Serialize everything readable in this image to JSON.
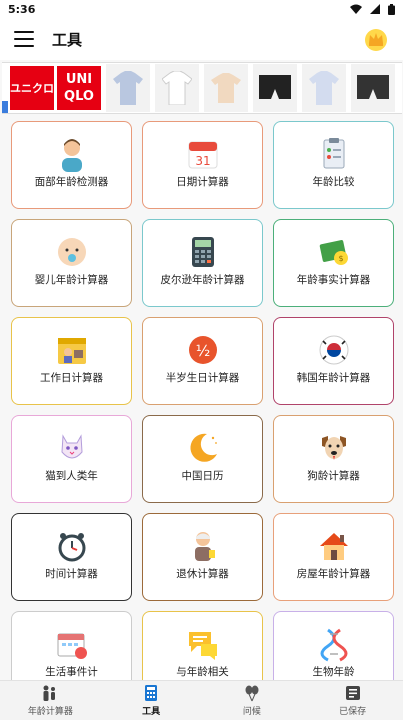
{
  "status_bar": {
    "time": "5:36"
  },
  "app_bar": {
    "title": "工具"
  },
  "ad": {
    "brand_line1": "ユニクロ",
    "brand_line2": "UNI QLO"
  },
  "cards": [
    {
      "label": "面部年龄检测器",
      "icon": "face-scan-icon",
      "border": "#e89a7a"
    },
    {
      "label": "日期计算器",
      "icon": "calendar-icon",
      "border": "#e89a7a"
    },
    {
      "label": "年龄比较",
      "icon": "clipboard-compare-icon",
      "border": "#7bc8cc"
    },
    {
      "label": "婴儿年龄计算器",
      "icon": "baby-icon",
      "border": "#c8a57a"
    },
    {
      "label": "皮尔逊年龄计算器",
      "icon": "calculator-icon",
      "border": "#7bc8cc"
    },
    {
      "label": "年龄事实计算器",
      "icon": "money-fact-icon",
      "border": "#4caf7a"
    },
    {
      "label": "工作日计算器",
      "icon": "work-calendar-icon",
      "border": "#e8c34a"
    },
    {
      "label": "半岁生日计算器",
      "icon": "half-birthday-icon",
      "border": "#d9a070"
    },
    {
      "label": "韩国年龄计算器",
      "icon": "korea-flag-icon",
      "border": "#b0436a"
    },
    {
      "label": "猫到人类年",
      "icon": "cat-icon",
      "border": "#e8a8d8"
    },
    {
      "label": "中国日历",
      "icon": "moon-icon",
      "border": "#8a6a4a"
    },
    {
      "label": "狗龄计算器",
      "icon": "dog-icon",
      "border": "#d9a070"
    },
    {
      "label": "时间计算器",
      "icon": "alarm-clock-icon",
      "border": "#333333"
    },
    {
      "label": "退休计算器",
      "icon": "retiree-icon",
      "border": "#9c6a3a"
    },
    {
      "label": "房屋年龄计算器",
      "icon": "house-icon",
      "border": "#e8a07a"
    },
    {
      "label": "生活事件计",
      "icon": "life-event-icon",
      "border": "#cccccc"
    },
    {
      "label": "与年龄相关",
      "icon": "chat-bubbles-icon",
      "border": "#e8c34a"
    },
    {
      "label": "生物年龄",
      "icon": "dna-icon",
      "border": "#c8b0e8"
    }
  ],
  "nav": [
    {
      "label": "年龄计算器",
      "icon": "family-icon"
    },
    {
      "label": "工具",
      "icon": "calculator-nav-icon"
    },
    {
      "label": "问候",
      "icon": "balloons-icon"
    },
    {
      "label": "已保存",
      "icon": "saved-list-icon"
    }
  ]
}
